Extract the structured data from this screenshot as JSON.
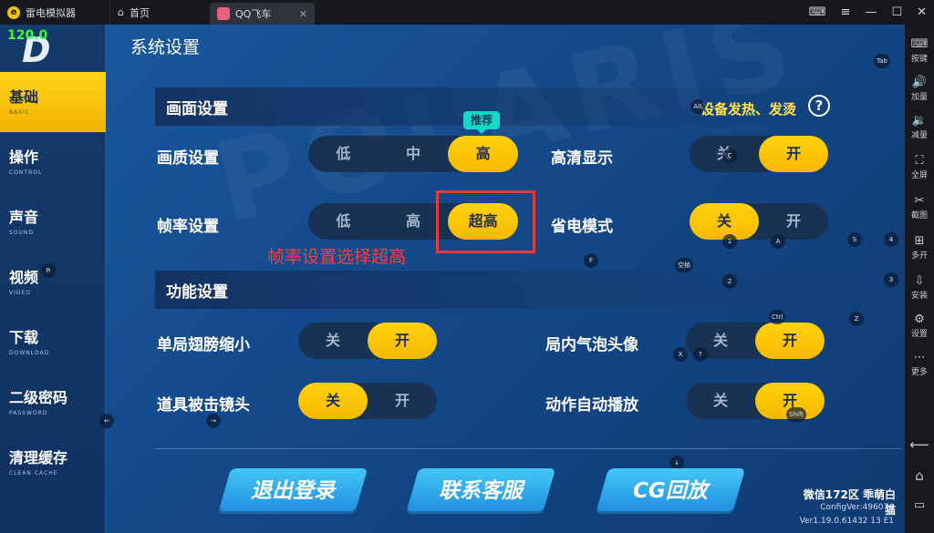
{
  "titlebar": {
    "tabs": [
      {
        "label": "雷电模拟器"
      },
      {
        "label": "首页"
      },
      {
        "label": "QQ飞车"
      }
    ]
  },
  "fps": "120.0",
  "sidebar": {
    "items": [
      {
        "cn": "基础",
        "en": "BASIC"
      },
      {
        "cn": "操作",
        "en": "CONTROL"
      },
      {
        "cn": "声音",
        "en": "SOUND"
      },
      {
        "cn": "视频",
        "en": "VIDEO"
      },
      {
        "cn": "下载",
        "en": "DOWNLOAD"
      },
      {
        "cn": "二级密码",
        "en": "PASSWORD"
      },
      {
        "cn": "清理缓存",
        "en": "CLEAN CACHE"
      }
    ]
  },
  "page_title": "系统设置",
  "sections": {
    "display": "画面设置",
    "function": "功能设置"
  },
  "recommend_badge": "推荐",
  "heat_link": "设备发热、发烫",
  "help_icon": "?",
  "settings": {
    "quality": {
      "label": "画质设置",
      "options": [
        "低",
        "中",
        "高"
      ],
      "selected": "高"
    },
    "hd": {
      "label": "高清显示",
      "options": [
        "关",
        "开"
      ],
      "selected": "开"
    },
    "framerate": {
      "label": "帧率设置",
      "options": [
        "低",
        "高",
        "超高"
      ],
      "selected": "超高"
    },
    "power_save": {
      "label": "省电模式",
      "options": [
        "关",
        "开"
      ],
      "selected": "关"
    },
    "shrink_wings": {
      "label": "单局翅膀缩小",
      "options": [
        "关",
        "开"
      ],
      "selected": "开"
    },
    "bubble_avatar": {
      "label": "局内气泡头像",
      "options": [
        "关",
        "开"
      ],
      "selected": "开"
    },
    "hit_camera": {
      "label": "道具被击镜头",
      "options": [
        "关",
        "开"
      ],
      "selected": "关"
    },
    "auto_play": {
      "label": "动作自动播放",
      "options": [
        "关",
        "开"
      ],
      "selected": "开"
    }
  },
  "annotation": "帧率设置选择超高",
  "key_hints": [
    "Tab",
    "Alt",
    "C",
    "1",
    "A",
    "S",
    "4",
    "F",
    "空格",
    "2",
    "3",
    "R",
    "Ctrl",
    "Z",
    "X",
    "↑",
    "←",
    "→",
    "Shift",
    "↓"
  ],
  "buttons": {
    "logout": "退出登录",
    "support": "联系客服",
    "cg": "CG回放"
  },
  "server": "微信172区 乖萌白猫",
  "config_ver": "ConfigVer:496074",
  "version": "Ver1.19.0.61432 13 E1",
  "rightbar": [
    {
      "icon": "keyboard-icon",
      "label": "按键"
    },
    {
      "icon": "volume-up-icon",
      "label": "加量"
    },
    {
      "icon": "volume-down-icon",
      "label": "减量"
    },
    {
      "icon": "fullscreen-icon",
      "label": "全屏"
    },
    {
      "icon": "scissors-icon",
      "label": "截图"
    },
    {
      "icon": "multi-open-icon",
      "label": "多开"
    },
    {
      "icon": "install-icon",
      "label": "安装"
    },
    {
      "icon": "gear-icon",
      "label": "设置"
    },
    {
      "icon": "more-icon",
      "label": "更多"
    }
  ],
  "colors": {
    "accent_yellow": "#f7b900",
    "annotation_red": "#e53a3a",
    "recommend_teal": "#15d7c8",
    "fps_green": "#37ff37"
  }
}
